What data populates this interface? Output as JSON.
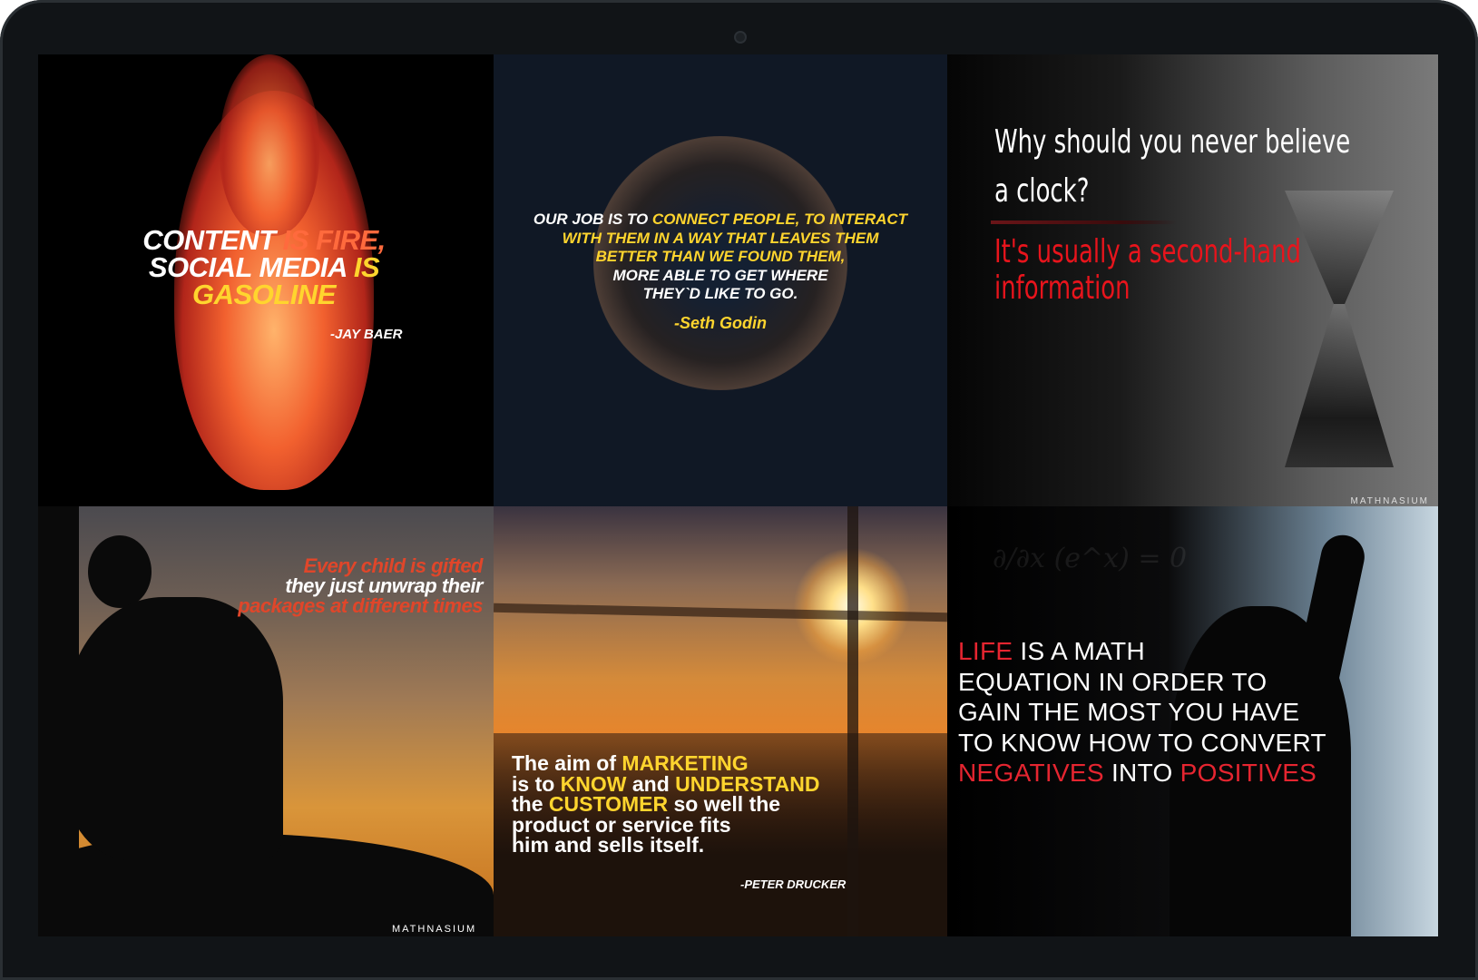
{
  "tile1": {
    "line1": "CONTENT ",
    "line1b": "IS FIRE,",
    "line2": "SOCIAL MEDIA ",
    "line2b": "IS",
    "line3": "GASOLINE",
    "author": "-JAY BAER"
  },
  "tile2": {
    "l1a": "OUR JOB IS TO ",
    "l1b": "CONNECT PEOPLE, TO INTERACT",
    "l2": "WITH THEM IN A WAY THAT LEAVES THEM",
    "l3": "BETTER THAN WE FOUND THEM,",
    "l4": "MORE ABLE TO GET WHERE",
    "l5": "THEY`D LIKE TO GO.",
    "author": "-Seth Godin"
  },
  "tile3": {
    "question": "Why should you never believe a clock?",
    "answer": "It's usually a second-hand information",
    "watermark": "MATHNASIUM"
  },
  "tile4": {
    "l1": "Every child is gifted",
    "l2": "they just unwrap their",
    "l3": "packages at different times",
    "watermark": "MATHNASIUM"
  },
  "tile5": {
    "l1a": "The aim of ",
    "l1b": "MARKETING",
    "l2a": "is to ",
    "l2b": "KNOW",
    "l2c": " and ",
    "l2d": "UNDERSTAND",
    "l3a": "the ",
    "l3b": "CUSTOMER",
    "l3c": " so well the",
    "l4": "product or service fits",
    "l5": "him and sells itself.",
    "author": "-PETER DRUCKER"
  },
  "tile6": {
    "l1a": "LIFE",
    "l1b": " IS A MATH",
    "l2": "EQUATION IN ORDER TO",
    "l3": "GAIN THE MOST YOU HAVE",
    "l4": "TO KNOW HOW TO CONVERT",
    "l5a": "NEGATIVES",
    "l5b": " INTO ",
    "l5c": "POSITIVES"
  }
}
